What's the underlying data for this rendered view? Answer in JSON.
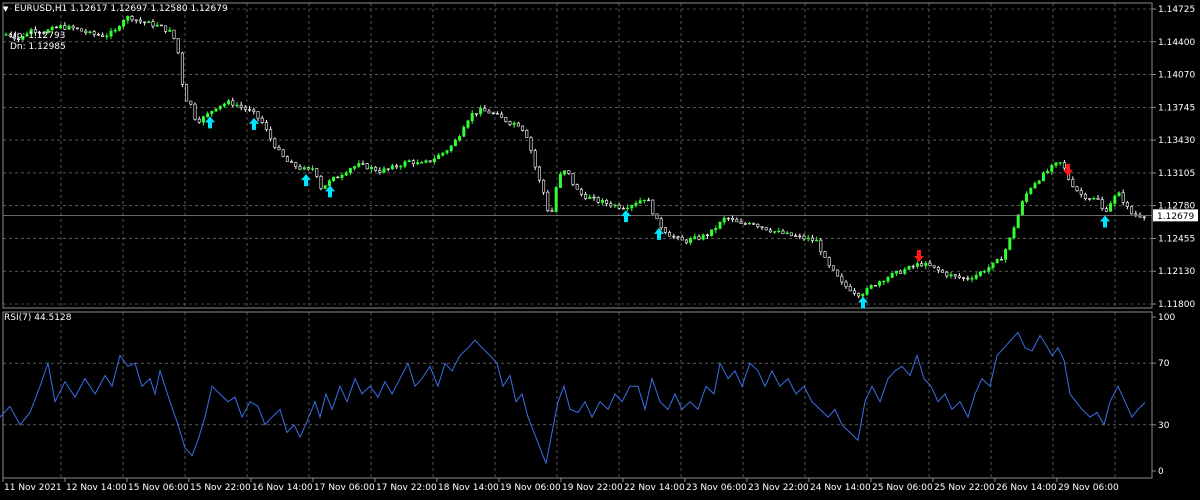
{
  "header": {
    "menu_glyph": "▼",
    "symbol_info": "EURUSD,H1  1.12617 1.12697 1.12580 1.12679",
    "up_label": "Up: 1.12793",
    "dn_label": "Dn: 1.12985"
  },
  "colors": {
    "background": "#000000",
    "grid": "#8a8a8a",
    "bull": "#33ff33",
    "bear": "#ffffff",
    "rsi_line": "#3a6fe8",
    "buy_arrow": "#00e5ff",
    "sell_arrow": "#ff1a1a",
    "current_price_line": "#8a8a8a"
  },
  "icons": {
    "buy_signal": "arrow-up-icon",
    "sell_signal": "arrow-down-icon"
  },
  "chart_data": [
    {
      "type": "candlestick",
      "symbol": "EURUSD",
      "timeframe": "H1",
      "y_ticks": [
        "1.14725",
        "1.14400",
        "1.14070",
        "1.13745",
        "1.13430",
        "1.13105",
        "1.12780",
        "1.12455",
        "1.12130",
        "1.11800"
      ],
      "ylim": [
        1.118,
        1.14725
      ],
      "current_price": "1.12679",
      "x_ticks": [
        "11 Nov 2021",
        "12 Nov 14:00",
        "15 Nov 06:00",
        "15 Nov 22:00",
        "16 Nov 14:00",
        "17 Nov 06:00",
        "17 Nov 22:00",
        "18 Nov 14:00",
        "19 Nov 06:00",
        "19 Nov 22:00",
        "22 Nov 14:00",
        "23 Nov 06:00",
        "23 Nov 22:00",
        "24 Nov 14:00",
        "25 Nov 06:00",
        "25 Nov 22:00",
        "26 Nov 14:00",
        "29 Nov 06:00"
      ],
      "close_path": [
        [
          0,
          1.1445
        ],
        [
          8,
          1.1448
        ],
        [
          20,
          1.1442
        ],
        [
          30,
          1.1452
        ],
        [
          45,
          1.145
        ],
        [
          60,
          1.1455
        ],
        [
          75,
          1.1453
        ],
        [
          90,
          1.1448
        ],
        [
          105,
          1.1446
        ],
        [
          115,
          1.145
        ],
        [
          122,
          1.1462
        ],
        [
          130,
          1.1465
        ],
        [
          140,
          1.146
        ],
        [
          150,
          1.1458
        ],
        [
          160,
          1.1455
        ],
        [
          170,
          1.145
        ],
        [
          176,
          1.144
        ],
        [
          180,
          1.142
        ],
        [
          184,
          1.1385
        ],
        [
          190,
          1.138
        ],
        [
          195,
          1.1365
        ],
        [
          200,
          1.1362
        ],
        [
          208,
          1.1368
        ],
        [
          215,
          1.1375
        ],
        [
          222,
          1.1378
        ],
        [
          230,
          1.138
        ],
        [
          240,
          1.1376
        ],
        [
          248,
          1.1372
        ],
        [
          255,
          1.1368
        ],
        [
          262,
          1.136
        ],
        [
          270,
          1.1345
        ],
        [
          278,
          1.1332
        ],
        [
          285,
          1.1323
        ],
        [
          292,
          1.1318
        ],
        [
          300,
          1.1315
        ],
        [
          308,
          1.1312
        ],
        [
          315,
          1.1316
        ],
        [
          320,
          1.1295
        ],
        [
          325,
          1.1298
        ],
        [
          332,
          1.1303
        ],
        [
          340,
          1.1308
        ],
        [
          350,
          1.1315
        ],
        [
          360,
          1.1318
        ],
        [
          370,
          1.1315
        ],
        [
          380,
          1.1312
        ],
        [
          390,
          1.1314
        ],
        [
          400,
          1.1318
        ],
        [
          410,
          1.1322
        ],
        [
          420,
          1.1318
        ],
        [
          430,
          1.1322
        ],
        [
          440,
          1.1328
        ],
        [
          450,
          1.1335
        ],
        [
          458,
          1.1345
        ],
        [
          465,
          1.136
        ],
        [
          472,
          1.1368
        ],
        [
          480,
          1.1372
        ],
        [
          490,
          1.137
        ],
        [
          500,
          1.1365
        ],
        [
          510,
          1.136
        ],
        [
          520,
          1.1358
        ],
        [
          528,
          1.1345
        ],
        [
          534,
          1.132
        ],
        [
          540,
          1.13
        ],
        [
          546,
          1.1285
        ],
        [
          550,
          1.126
        ],
        [
          556,
          1.1295
        ],
        [
          562,
          1.1312
        ],
        [
          568,
          1.131
        ],
        [
          575,
          1.1295
        ],
        [
          582,
          1.1288
        ],
        [
          590,
          1.1285
        ],
        [
          598,
          1.1282
        ],
        [
          606,
          1.128
        ],
        [
          614,
          1.1278
        ],
        [
          622,
          1.1276
        ],
        [
          630,
          1.1278
        ],
        [
          638,
          1.1282
        ],
        [
          645,
          1.1285
        ],
        [
          650,
          1.128
        ],
        [
          655,
          1.1265
        ],
        [
          660,
          1.1258
        ],
        [
          668,
          1.125
        ],
        [
          676,
          1.1245
        ],
        [
          684,
          1.1242
        ],
        [
          692,
          1.1244
        ],
        [
          700,
          1.1246
        ],
        [
          710,
          1.125
        ],
        [
          718,
          1.1258
        ],
        [
          726,
          1.1266
        ],
        [
          734,
          1.1262
        ],
        [
          742,
          1.1258
        ],
        [
          750,
          1.1262
        ],
        [
          758,
          1.1258
        ],
        [
          766,
          1.1255
        ],
        [
          774,
          1.1252
        ],
        [
          782,
          1.125
        ],
        [
          790,
          1.1248
        ],
        [
          800,
          1.1246
        ],
        [
          810,
          1.1244
        ],
        [
          818,
          1.1242
        ],
        [
          822,
          1.123
        ],
        [
          828,
          1.1218
        ],
        [
          835,
          1.121
        ],
        [
          842,
          1.12
        ],
        [
          850,
          1.1195
        ],
        [
          858,
          1.119
        ],
        [
          865,
          1.1192
        ],
        [
          872,
          1.1198
        ],
        [
          880,
          1.1203
        ],
        [
          890,
          1.1208
        ],
        [
          900,
          1.1212
        ],
        [
          910,
          1.1216
        ],
        [
          920,
          1.122
        ],
        [
          928,
          1.1218
        ],
        [
          935,
          1.1215
        ],
        [
          945,
          1.121
        ],
        [
          955,
          1.1207
        ],
        [
          965,
          1.1205
        ],
        [
          975,
          1.1208
        ],
        [
          985,
          1.1214
        ],
        [
          995,
          1.122
        ],
        [
          1003,
          1.1228
        ],
        [
          1010,
          1.1245
        ],
        [
          1017,
          1.1265
        ],
        [
          1024,
          1.1285
        ],
        [
          1032,
          1.1298
        ],
        [
          1040,
          1.1305
        ],
        [
          1048,
          1.1312
        ],
        [
          1055,
          1.1318
        ],
        [
          1062,
          1.132
        ],
        [
          1068,
          1.1305
        ],
        [
          1075,
          1.1295
        ],
        [
          1082,
          1.1288
        ],
        [
          1090,
          1.1285
        ],
        [
          1098,
          1.1283
        ],
        [
          1104,
          1.127
        ],
        [
          1110,
          1.128
        ],
        [
          1118,
          1.129
        ],
        [
          1125,
          1.128
        ],
        [
          1130,
          1.127
        ],
        [
          1138,
          1.1268
        ],
        [
          1145,
          1.1268
        ]
      ],
      "buy_signals_x": [
        210,
        254,
        306,
        330,
        626,
        659,
        863,
        1105
      ],
      "sell_signals_x": [
        919,
        1068
      ]
    },
    {
      "type": "line",
      "indicator_label": "RSI(7) 44.5128",
      "y_ticks": [
        "100",
        "70",
        "30",
        "0"
      ],
      "ylim": [
        0,
        100
      ],
      "values_path": [
        [
          0,
          35
        ],
        [
          10,
          42
        ],
        [
          20,
          30
        ],
        [
          30,
          38
        ],
        [
          40,
          55
        ],
        [
          48,
          70
        ],
        [
          55,
          45
        ],
        [
          65,
          58
        ],
        [
          75,
          48
        ],
        [
          85,
          60
        ],
        [
          95,
          50
        ],
        [
          105,
          62
        ],
        [
          112,
          55
        ],
        [
          120,
          75
        ],
        [
          128,
          68
        ],
        [
          135,
          70
        ],
        [
          142,
          55
        ],
        [
          150,
          60
        ],
        [
          155,
          50
        ],
        [
          160,
          65
        ],
        [
          165,
          55
        ],
        [
          170,
          45
        ],
        [
          178,
          30
        ],
        [
          185,
          15
        ],
        [
          192,
          10
        ],
        [
          198,
          20
        ],
        [
          205,
          35
        ],
        [
          212,
          55
        ],
        [
          220,
          50
        ],
        [
          228,
          45
        ],
        [
          235,
          48
        ],
        [
          242,
          35
        ],
        [
          250,
          45
        ],
        [
          258,
          42
        ],
        [
          265,
          30
        ],
        [
          272,
          35
        ],
        [
          280,
          40
        ],
        [
          287,
          25
        ],
        [
          294,
          30
        ],
        [
          300,
          22
        ],
        [
          307,
          32
        ],
        [
          315,
          45
        ],
        [
          320,
          35
        ],
        [
          326,
          50
        ],
        [
          332,
          40
        ],
        [
          340,
          55
        ],
        [
          347,
          45
        ],
        [
          355,
          60
        ],
        [
          362,
          50
        ],
        [
          370,
          55
        ],
        [
          378,
          48
        ],
        [
          385,
          58
        ],
        [
          392,
          50
        ],
        [
          400,
          60
        ],
        [
          408,
          70
        ],
        [
          415,
          55
        ],
        [
          422,
          60
        ],
        [
          430,
          68
        ],
        [
          438,
          55
        ],
        [
          445,
          70
        ],
        [
          452,
          65
        ],
        [
          460,
          75
        ],
        [
          468,
          80
        ],
        [
          475,
          85
        ],
        [
          482,
          80
        ],
        [
          490,
          75
        ],
        [
          497,
          70
        ],
        [
          503,
          55
        ],
        [
          510,
          62
        ],
        [
          516,
          45
        ],
        [
          522,
          50
        ],
        [
          528,
          35
        ],
        [
          534,
          25
        ],
        [
          540,
          15
        ],
        [
          546,
          5
        ],
        [
          552,
          25
        ],
        [
          558,
          45
        ],
        [
          564,
          55
        ],
        [
          570,
          40
        ],
        [
          578,
          38
        ],
        [
          585,
          45
        ],
        [
          592,
          35
        ],
        [
          600,
          45
        ],
        [
          608,
          40
        ],
        [
          615,
          50
        ],
        [
          622,
          45
        ],
        [
          630,
          55
        ],
        [
          638,
          55
        ],
        [
          645,
          40
        ],
        [
          652,
          60
        ],
        [
          660,
          45
        ],
        [
          668,
          40
        ],
        [
          675,
          50
        ],
        [
          682,
          40
        ],
        [
          690,
          45
        ],
        [
          698,
          40
        ],
        [
          706,
          55
        ],
        [
          714,
          50
        ],
        [
          720,
          70
        ],
        [
          728,
          60
        ],
        [
          735,
          65
        ],
        [
          742,
          55
        ],
        [
          750,
          70
        ],
        [
          758,
          65
        ],
        [
          765,
          55
        ],
        [
          772,
          65
        ],
        [
          780,
          55
        ],
        [
          788,
          60
        ],
        [
          796,
          50
        ],
        [
          804,
          55
        ],
        [
          812,
          45
        ],
        [
          820,
          40
        ],
        [
          828,
          35
        ],
        [
          835,
          40
        ],
        [
          842,
          30
        ],
        [
          850,
          25
        ],
        [
          858,
          20
        ],
        [
          865,
          45
        ],
        [
          872,
          55
        ],
        [
          880,
          45
        ],
        [
          888,
          60
        ],
        [
          895,
          65
        ],
        [
          902,
          68
        ],
        [
          910,
          62
        ],
        [
          917,
          75
        ],
        [
          924,
          60
        ],
        [
          931,
          55
        ],
        [
          938,
          45
        ],
        [
          945,
          50
        ],
        [
          952,
          40
        ],
        [
          960,
          45
        ],
        [
          968,
          35
        ],
        [
          975,
          50
        ],
        [
          982,
          60
        ],
        [
          990,
          55
        ],
        [
          997,
          75
        ],
        [
          1004,
          80
        ],
        [
          1011,
          85
        ],
        [
          1018,
          90
        ],
        [
          1025,
          80
        ],
        [
          1032,
          78
        ],
        [
          1040,
          88
        ],
        [
          1046,
          82
        ],
        [
          1052,
          75
        ],
        [
          1058,
          80
        ],
        [
          1064,
          72
        ],
        [
          1070,
          50
        ],
        [
          1076,
          45
        ],
        [
          1082,
          40
        ],
        [
          1090,
          35
        ],
        [
          1097,
          38
        ],
        [
          1104,
          30
        ],
        [
          1110,
          45
        ],
        [
          1118,
          55
        ],
        [
          1125,
          45
        ],
        [
          1132,
          35
        ],
        [
          1138,
          40
        ],
        [
          1145,
          44.5
        ]
      ]
    }
  ]
}
